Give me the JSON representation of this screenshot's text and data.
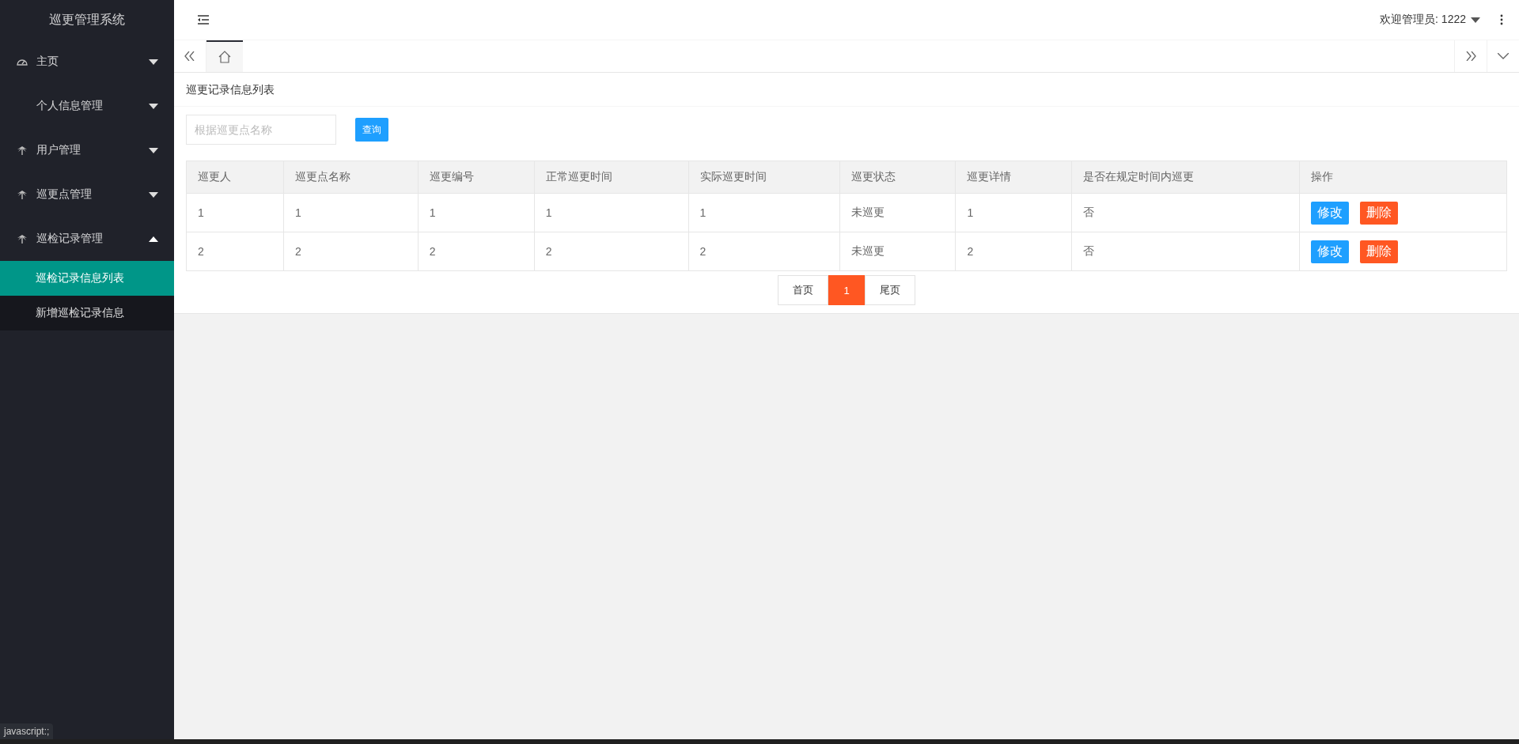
{
  "sidebar": {
    "title": "巡更管理系统",
    "items": [
      {
        "label": "主页",
        "kind": "dashboard",
        "expanded": false
      },
      {
        "label": "个人信息管理",
        "kind": "plain",
        "expanded": false
      },
      {
        "label": "用户管理",
        "kind": "module",
        "expanded": false
      },
      {
        "label": "巡更点管理",
        "kind": "module",
        "expanded": false
      },
      {
        "label": "巡检记录管理",
        "kind": "module",
        "expanded": true,
        "children": [
          {
            "label": "巡检记录信息列表",
            "selected": true
          },
          {
            "label": "新增巡检记录信息",
            "selected": false
          }
        ]
      }
    ]
  },
  "header": {
    "user_menu": "欢迎管理员: 1222"
  },
  "tabs": [
    {
      "kind": "home",
      "selected": true
    }
  ],
  "card": {
    "title": "巡更记录信息列表",
    "search": {
      "placeholder": "根据巡更点名称"
    },
    "search_button": "查询",
    "table": {
      "columns": [
        "巡更人",
        "巡更点名称",
        "巡更编号",
        "正常巡更时间",
        "实际巡更时间",
        "巡更状态",
        "巡更详情",
        "是否在规定时间内巡更",
        "操作"
      ],
      "rows": [
        {
          "cells": [
            "1",
            "1",
            "1",
            "1",
            "1",
            "未巡更",
            "1",
            "否"
          ],
          "actions": [
            "修改",
            "删除"
          ]
        },
        {
          "cells": [
            "2",
            "2",
            "2",
            "2",
            "2",
            "未巡更",
            "2",
            "否"
          ],
          "actions": [
            "修改",
            "删除"
          ]
        }
      ]
    },
    "pagination": {
      "first": "首页",
      "pages": [
        {
          "label": "1",
          "selected": true
        }
      ],
      "last": "尾页"
    }
  },
  "status_bar": "javascript:;"
}
